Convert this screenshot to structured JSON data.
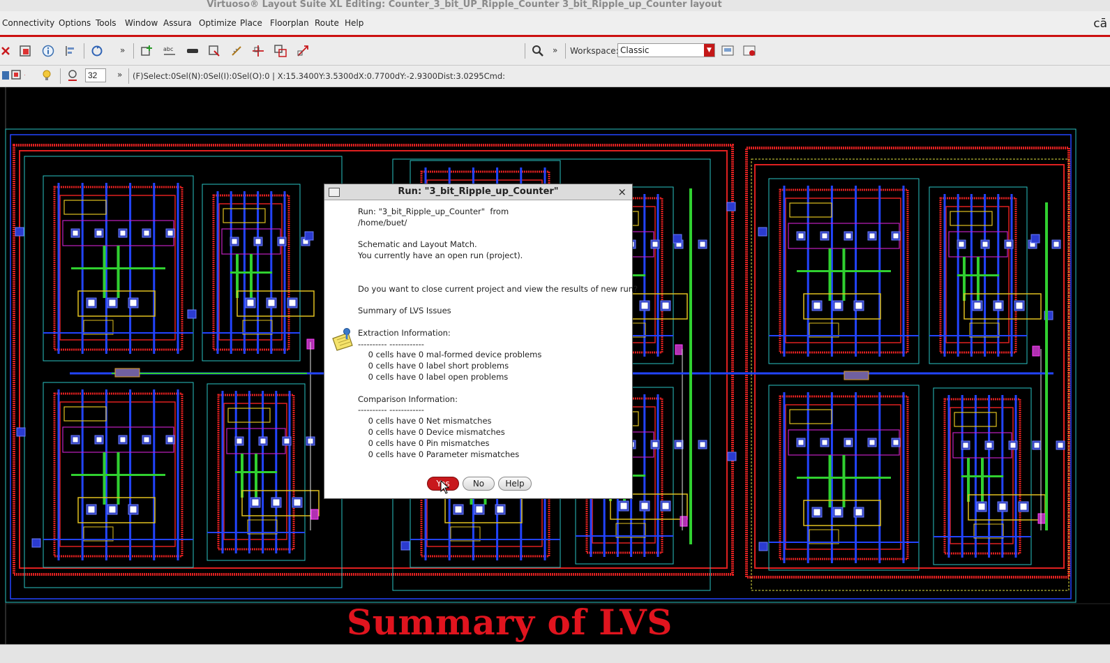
{
  "window": {
    "title": "Virtuoso® Layout Suite XL Editing: Counter_3_bit_UP_Ripple_Counter 3_bit_Ripple_up_Counter layout"
  },
  "menubar": {
    "items": [
      "Connectivity",
      "Options",
      "Tools",
      "Window",
      "Assura",
      "Optimize",
      "Place",
      "Floorplan",
      "Route",
      "Help"
    ],
    "brand": "cā"
  },
  "toolbar": {
    "workspace_label": "Workspace:",
    "workspace_value": "Classic",
    "zoom_value": "32",
    "overflow": "»",
    "status": "(F)Select:0Sel(N):0Sel(I):0Sel(O):0 | X:15.3400Y:3.5300dX:0.7700dY:-2.9300Dist:3.0295Cmd:"
  },
  "icons": {
    "close": "close-icon",
    "search": "search-icon",
    "info": "info-icon",
    "workspace_save": "save-workspace-icon",
    "workspace_load": "load-workspace-icon",
    "bulb": "lightbulb-icon",
    "note": "note-icon"
  },
  "colors": {
    "accent_red": "#cc1010",
    "yes_button": "#c8181c",
    "caption": "#e0141e",
    "canvas": "#000000"
  },
  "dialog": {
    "title": "Run: \"3_bit_Ripple_up_Counter\"",
    "close": "×",
    "body": "Run: \"3_bit_Ripple_up_Counter\"  from\n/home/buet/\n\nSchematic and Layout Match.\nYou currently have an open run (project).\n\n\nDo you want to close current project and view the results of new run?\n\nSummary of LVS Issues\n\nExtraction Information:\n---------- ------------\n    0 cells have 0 mal-formed device problems\n    0 cells have 0 label short problems\n    0 cells have 0 label open problems\n\nComparison Information:\n---------- ------------\n    0 cells have 0 Net mismatches\n    0 cells have 0 Device mismatches\n    0 cells have 0 Pin mismatches\n    0 cells have 0 Parameter mismatches",
    "buttons": {
      "yes": "Yes",
      "no": "No",
      "help": "Help"
    }
  },
  "caption": "Summary of LVS"
}
